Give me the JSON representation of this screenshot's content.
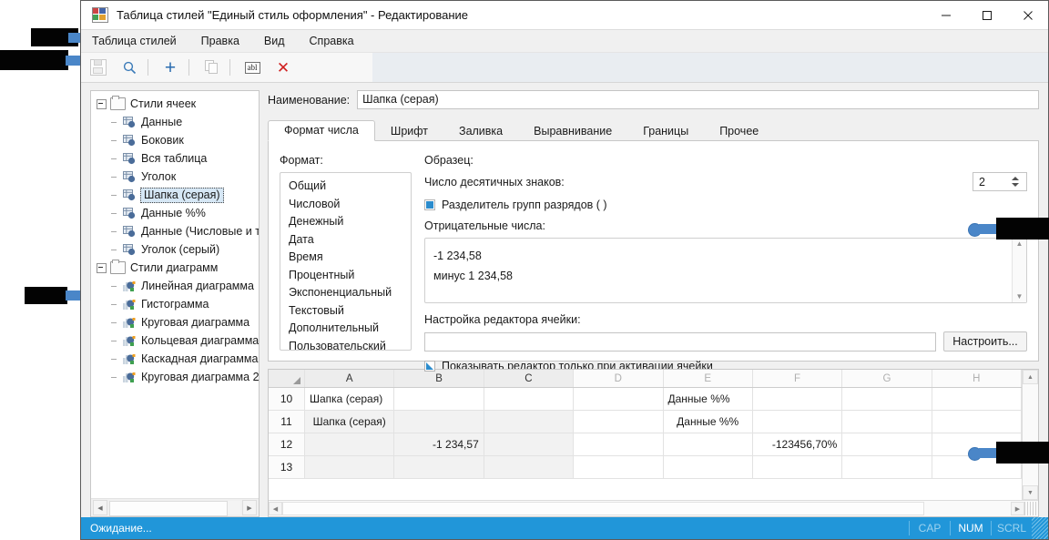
{
  "window": {
    "title": "Таблица стилей \"Единый стиль оформления\" - Редактирование",
    "icon": "style-table-icon",
    "minimize": "−",
    "maximize": "□",
    "close": "✕"
  },
  "menubar": {
    "items": [
      {
        "label": "Таблица стилей"
      },
      {
        "label": "Правка"
      },
      {
        "label": "Вид"
      },
      {
        "label": "Справка"
      }
    ]
  },
  "toolbar": {
    "buttons": [
      {
        "name": "save-icon",
        "glyph": ""
      },
      {
        "name": "search-icon",
        "glyph": ""
      },
      {
        "name": "add-icon",
        "glyph": "+"
      },
      {
        "name": "copy-icon",
        "glyph": ""
      },
      {
        "name": "rename-icon",
        "glyph": "abl"
      },
      {
        "name": "delete-icon",
        "glyph": "✕"
      }
    ]
  },
  "tree": {
    "groups": [
      {
        "label": "Стили ячеек",
        "items": [
          {
            "label": "Данные",
            "selected": false
          },
          {
            "label": "Боковик",
            "selected": false
          },
          {
            "label": "Вся таблица",
            "selected": false
          },
          {
            "label": "Уголок",
            "selected": false
          },
          {
            "label": "Шапка (серая)",
            "selected": true
          },
          {
            "label": "Данные %%",
            "selected": false
          },
          {
            "label": "Данные (Числовые и ты",
            "selected": false
          },
          {
            "label": "Уголок (серый)",
            "selected": false
          }
        ]
      },
      {
        "label": "Стили диаграмм",
        "items": [
          {
            "label": "Линейная диаграмма",
            "selected": false
          },
          {
            "label": "Гистограмма",
            "selected": false
          },
          {
            "label": "Круговая диаграмма",
            "selected": false
          },
          {
            "label": "Кольцевая диаграмма",
            "selected": false
          },
          {
            "label": "Каскадная диаграмма",
            "selected": false
          },
          {
            "label": "Круговая диаграмма 2",
            "selected": false
          }
        ]
      }
    ]
  },
  "name_field": {
    "label": "Наименование:",
    "value": "Шапка (серая)"
  },
  "tabs": [
    {
      "label": "Формат числа",
      "active": true
    },
    {
      "label": "Шрифт",
      "active": false
    },
    {
      "label": "Заливка",
      "active": false
    },
    {
      "label": "Выравнивание",
      "active": false
    },
    {
      "label": "Границы",
      "active": false
    },
    {
      "label": "Прочее",
      "active": false
    }
  ],
  "format_panel": {
    "format_label": "Формат:",
    "format_items": [
      "Общий",
      "Числовой",
      "Денежный",
      "Дата",
      "Время",
      "Процентный",
      "Экспоненциальный",
      "Текстовый",
      "Дополнительный",
      "Пользовательский"
    ],
    "sample_label": "Образец:",
    "decimals_label": "Число десятичных знаков:",
    "decimals_value": "2",
    "group_sep_label": "Разделитель групп разрядов ( )",
    "group_sep_checked": true,
    "negative_label": "Отрицательные числа:",
    "negative_items": [
      "-1 234,58",
      "минус 1 234,58"
    ],
    "editor_setup_label": "Настройка редактора ячейки:",
    "editor_setup_value": "",
    "configure_button": "Настроить...",
    "show_editor_label": "Показывать редактор только при активации ячейки",
    "show_editor_checked": true
  },
  "sheet": {
    "columns": [
      "A",
      "B",
      "C",
      "D",
      "E",
      "F",
      "G",
      "H"
    ],
    "active_columns": [
      "A",
      "B",
      "C"
    ],
    "rows": [
      {
        "num": "10",
        "cells": [
          "Шапка (серая)",
          "",
          "",
          "",
          "Данные %%",
          "",
          "",
          ""
        ]
      },
      {
        "num": "11",
        "cells": [
          "Шапка (серая)",
          "",
          "",
          "",
          "Данные %%",
          "",
          "",
          ""
        ]
      },
      {
        "num": "12",
        "cells": [
          "",
          "-1 234,57",
          "",
          "",
          "",
          "-123456,70%",
          "",
          ""
        ]
      },
      {
        "num": "13",
        "cells": [
          "",
          "",
          "",
          "",
          "",
          "",
          "",
          ""
        ]
      }
    ]
  },
  "statusbar": {
    "message": "Ожидание...",
    "indicators": [
      {
        "label": "CAP",
        "active": false
      },
      {
        "label": "NUM",
        "active": true
      },
      {
        "label": "SCRL",
        "active": false
      }
    ]
  },
  "colors": {
    "accent": "#2196d9",
    "selection": "#d6e7f5",
    "callout": "#4a86c8",
    "redaction": "#030303"
  }
}
